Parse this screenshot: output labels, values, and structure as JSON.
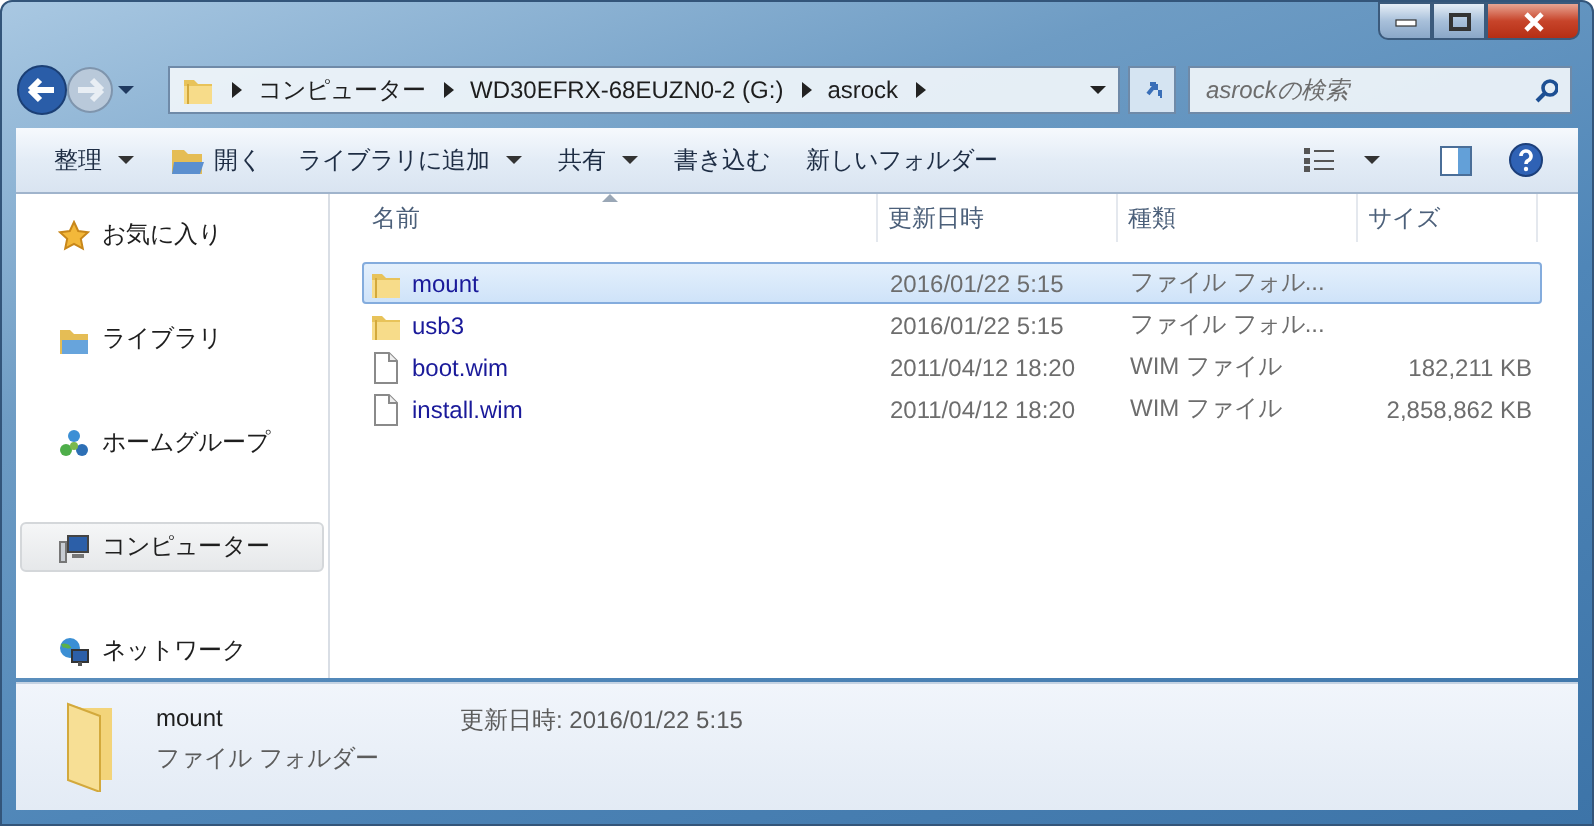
{
  "address": {
    "crumbs": [
      "コンピューター",
      "WD30EFRX-68EUZN0-2 (G:)",
      "asrock"
    ]
  },
  "search": {
    "placeholder": "asrockの検索"
  },
  "toolbar": [
    {
      "label": "整理",
      "dropdown": true,
      "kind": "text"
    },
    {
      "label": "開く",
      "dropdown": false,
      "kind": "open"
    },
    {
      "label": "ライブラリに追加",
      "dropdown": true,
      "kind": "text"
    },
    {
      "label": "共有",
      "dropdown": true,
      "kind": "text"
    },
    {
      "label": "書き込む",
      "dropdown": false,
      "kind": "text"
    },
    {
      "label": "新しいフォルダー",
      "dropdown": false,
      "kind": "text"
    }
  ],
  "sidebar": {
    "items": [
      {
        "label": "お気に入り",
        "kind": "favorites",
        "selected": false
      },
      {
        "label": "ライブラリ",
        "kind": "library",
        "selected": false
      },
      {
        "label": "ホームグループ",
        "kind": "homegroup",
        "selected": false
      },
      {
        "label": "コンピューター",
        "kind": "computer",
        "selected": true
      },
      {
        "label": "ネットワーク",
        "kind": "network",
        "selected": false
      }
    ]
  },
  "table": {
    "columns": [
      {
        "label": "名前",
        "sorted": true
      },
      {
        "label": "更新日時",
        "sorted": false
      },
      {
        "label": "種類",
        "sorted": false
      },
      {
        "label": "サイズ",
        "sorted": false
      }
    ],
    "rows": [
      {
        "name": "mount",
        "kind": "folder",
        "date": "2016/01/22 5:15",
        "type": "ファイル フォル...",
        "selected": true
      },
      {
        "name": "usb3",
        "kind": "folder",
        "date": "2016/01/22 5:15",
        "type": "ファイル フォル...",
        "selected": false
      },
      {
        "name": "boot.wim",
        "kind": "file",
        "date": "2011/04/12 18:20",
        "type": "WIM ファイル",
        "size": "182,211 KB",
        "selected": false
      },
      {
        "name": "install.wim",
        "kind": "file",
        "date": "2011/04/12 18:20",
        "type": "WIM ファイル",
        "size": "2,858,862 KB",
        "selected": false
      }
    ]
  },
  "details": {
    "name": "mount",
    "type": "ファイル フォルダー",
    "modified": "更新日時: 2016/01/22 5:15"
  }
}
